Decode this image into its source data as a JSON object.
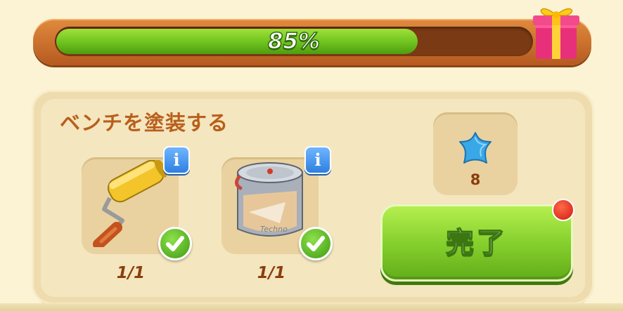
{
  "progress": {
    "percent_label": "85%",
    "value": 0.85
  },
  "task": {
    "title": "ベンチを塗装する",
    "requirements": [
      {
        "name": "paint-roller",
        "count": "1/1",
        "completed": true,
        "info_label": "i"
      },
      {
        "name": "paint-can",
        "count": "1/1",
        "completed": true,
        "info_label": "i"
      }
    ]
  },
  "reward": {
    "icon": "blue-star-icon",
    "amount": "8"
  },
  "action": {
    "label": "完了",
    "has_notification": true
  },
  "colors": {
    "bar_frame": "#c86e2a",
    "bar_fill": "#7ccb22",
    "panel": "#efdcae",
    "title_text": "#b85f1c",
    "button": "#86d02d",
    "notification": "#e0261a"
  }
}
